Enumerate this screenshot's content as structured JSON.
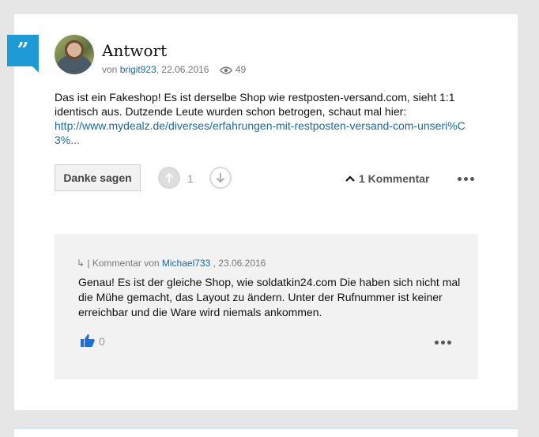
{
  "post": {
    "title": "Antwort",
    "meta_prefix": "von",
    "author": "brigit923",
    "date": ", 22.06.2016",
    "views": "49",
    "body_text": "Das ist ein Fakeshop! Es ist derselbe Shop wie restposten-versand.com, sieht 1:1 identisch aus. Dutzende Leute wurden schon betrogen, schaut mal hier:",
    "link": "http://www.mydealz.de/diverses/erfahrungen-mit-restposten-versand-com-unseri%C3%...",
    "thanks_label": "Danke sagen",
    "vote_count": "1",
    "comment_toggle_label": "1 Kommentar"
  },
  "reply": {
    "prefix": "↳ | Kommentar von",
    "author": "Michael733",
    "date": ", 23.06.2016",
    "text": "Genau! Es ist der gleiche Shop, wie soldatkin24.com Die haben sich nicht mal die Mühe gemacht, das Layout zu ändern. Unter der Rufnummer ist keiner erreichbar und die Ware wird niemals ankommen.",
    "like_count": "0"
  },
  "colors": {
    "accent": "#1e9bd7",
    "link": "#1a6aa0",
    "background": "#e6e6e6"
  },
  "icons": [
    "quote-icon",
    "eye-icon",
    "arrow-up-icon",
    "arrow-down-icon",
    "chevron-up-icon",
    "more-icon",
    "thumbs-up-icon"
  ]
}
